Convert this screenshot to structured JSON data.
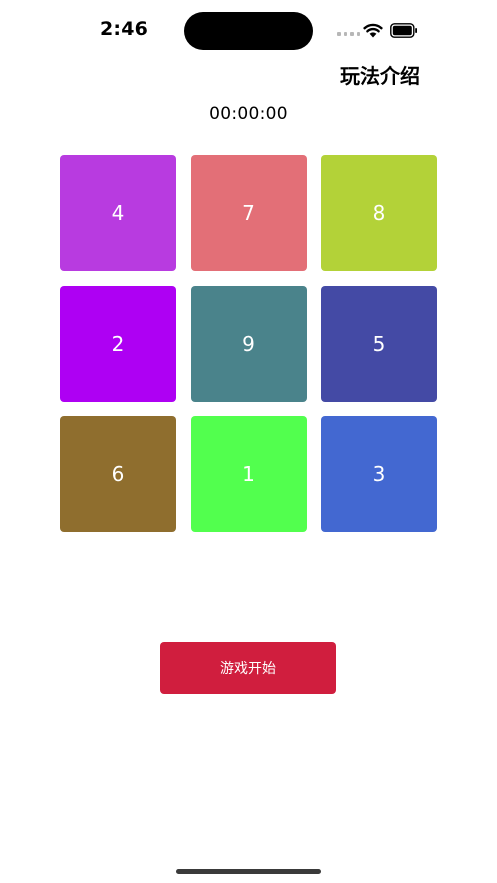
{
  "status_bar": {
    "time": "2:46"
  },
  "nav": {
    "action_label": "玩法介绍"
  },
  "timer": {
    "value": "00:00:00"
  },
  "tiles": [
    {
      "label": "4",
      "color": "#B83BE0"
    },
    {
      "label": "7",
      "color": "#E36F77"
    },
    {
      "label": "8",
      "color": "#B3D238"
    },
    {
      "label": "2",
      "color": "#AE00F3"
    },
    {
      "label": "9",
      "color": "#4A838B"
    },
    {
      "label": "5",
      "color": "#444AA5"
    },
    {
      "label": "6",
      "color": "#8F6E2E"
    },
    {
      "label": "1",
      "color": "#52FF4E"
    },
    {
      "label": "3",
      "color": "#4368D1"
    }
  ],
  "start_button": {
    "label": "游戏开始",
    "color": "#D01E3E"
  }
}
